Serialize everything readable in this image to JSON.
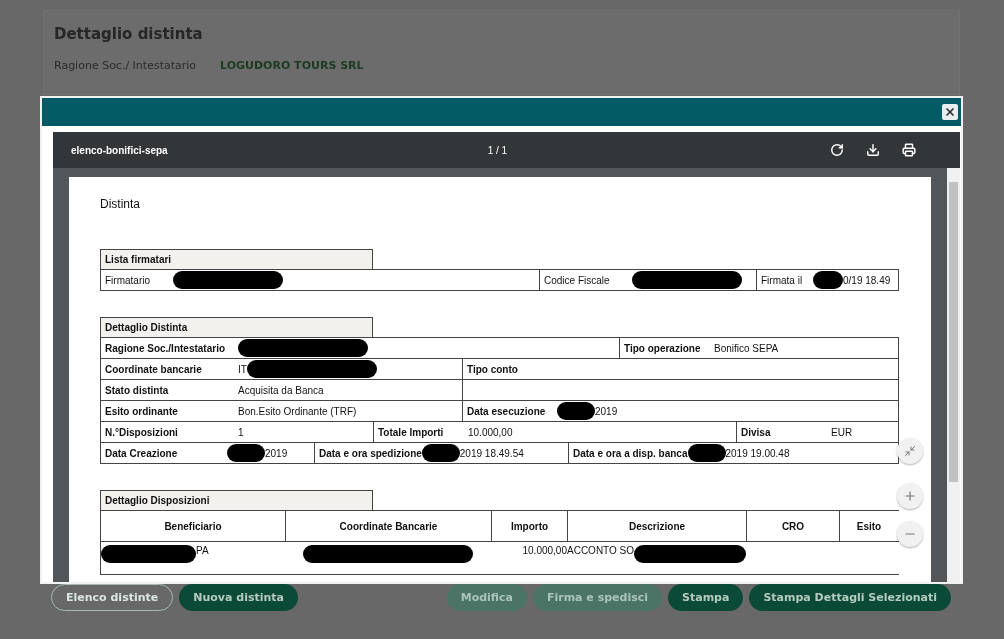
{
  "page": {
    "title": "Dettaglio distinta",
    "field_label": "Ragione Soc./ Intestatario",
    "field_value": "LOGUDORO TOURS SRL"
  },
  "footer_buttons": [
    {
      "label": "Elenco distinte",
      "kind": "outline",
      "disabled": false
    },
    {
      "label": "Nuova distinta",
      "kind": "filled",
      "disabled": false
    }
  ],
  "action_buttons": [
    {
      "label": "Modifica",
      "disabled": true
    },
    {
      "label": "Firma e spedisci",
      "disabled": true
    },
    {
      "label": "Stampa",
      "disabled": false
    },
    {
      "label": "Stampa Dettagli Selezionati",
      "disabled": false
    }
  ],
  "viewer": {
    "file_name": "elenco-bonifici-sepa",
    "page_counter": "1 / 1"
  },
  "document": {
    "title": "Distinta",
    "signers": {
      "heading": "Lista firmatari",
      "rows": [
        [
          {
            "label": "Firmatario",
            "redacted": true
          },
          {
            "label": "Codice Fiscale",
            "redacted": true
          },
          {
            "label": "Firmata il",
            "value": "0/19 18.49",
            "redacted": true,
            "value_first": false
          }
        ]
      ]
    },
    "details": {
      "heading": "Dettaglio Distinta",
      "rows": [
        [
          {
            "label": "Ragione Soc./Intestatario",
            "redacted": true
          },
          {
            "label": "Tipo operazione",
            "value": "Bonifico SEPA"
          }
        ],
        [
          {
            "label": "Coordinate bancarie",
            "value": "IT",
            "redacted": true,
            "value_first": true
          },
          {
            "label": "Tipo conto"
          }
        ],
        [
          {
            "label": "Stato distinta",
            "value": "Acquisita da Banca"
          },
          {}
        ],
        [
          {
            "label": "Esito ordinante",
            "value": "Bon.Esito Ordinante (TRF)"
          },
          {
            "label": "Data esecuzione",
            "value": "2019",
            "redacted": true,
            "value_first": false
          }
        ],
        [
          {
            "label": "N.°Disposizioni",
            "value": "1"
          },
          {
            "label": "Totale Importi",
            "value": "10.000,00"
          },
          {
            "label": "Divisa",
            "value": "EUR"
          }
        ],
        [
          {
            "label": "Data Creazione",
            "value": "2019",
            "redacted": true,
            "value_first": false
          },
          {
            "label": "Data e ora spedizione",
            "value": "2019 18.49.54",
            "redacted": true,
            "value_first": false
          },
          {
            "label": "Data e ora a disp. banca",
            "value": "2019 19.00.48",
            "redacted": true,
            "value_first": false
          }
        ]
      ]
    },
    "orders": {
      "heading": "Dettaglio Disposizioni",
      "columns": [
        "Beneficiario",
        "Coordinate Bancarie",
        "Importo",
        "Descrizione",
        "CRO",
        "Esito"
      ],
      "rows": [
        [
          {
            "value": "PA",
            "redacted": true,
            "value_first": false
          },
          {
            "redacted": true
          },
          {
            "value": "10.000,00"
          },
          {
            "value": "ACCONTO SO",
            "redacted": true,
            "value_first": true
          },
          {},
          {}
        ]
      ]
    }
  }
}
